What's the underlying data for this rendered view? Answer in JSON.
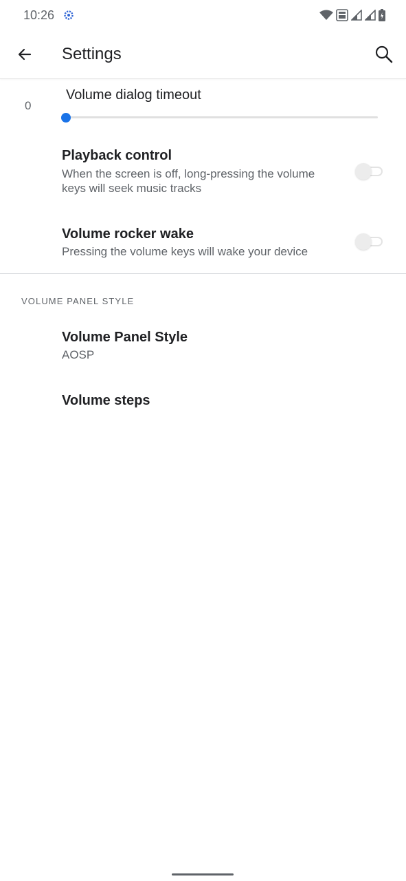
{
  "status_bar": {
    "time": "10:26",
    "icons": [
      "settings-gear-icon",
      "wifi-icon",
      "volte-icon",
      "signal-icon",
      "signal-icon-2",
      "battery-icon"
    ]
  },
  "app_bar": {
    "title": "Settings",
    "back_icon": "arrow-back-icon",
    "search_icon": "search-icon"
  },
  "volume_timeout": {
    "title": "Volume dialog timeout",
    "value": "0",
    "slider_fraction": 0
  },
  "playback_control": {
    "title": "Playback control",
    "summary": "When the screen is off, long-pressing the volume keys will seek music tracks",
    "enabled": false
  },
  "volume_rocker_wake": {
    "title": "Volume rocker wake",
    "summary": "Pressing the volume keys will wake your device",
    "enabled": false
  },
  "volume_panel_section": {
    "header": "VOLUME PANEL STYLE",
    "panel_style": {
      "title": "Volume Panel Style",
      "summary": "AOSP"
    },
    "volume_steps": {
      "title": "Volume steps"
    }
  },
  "colors": {
    "accent": "#1a73e8",
    "text_primary": "#202124",
    "text_secondary": "#5f6368"
  }
}
